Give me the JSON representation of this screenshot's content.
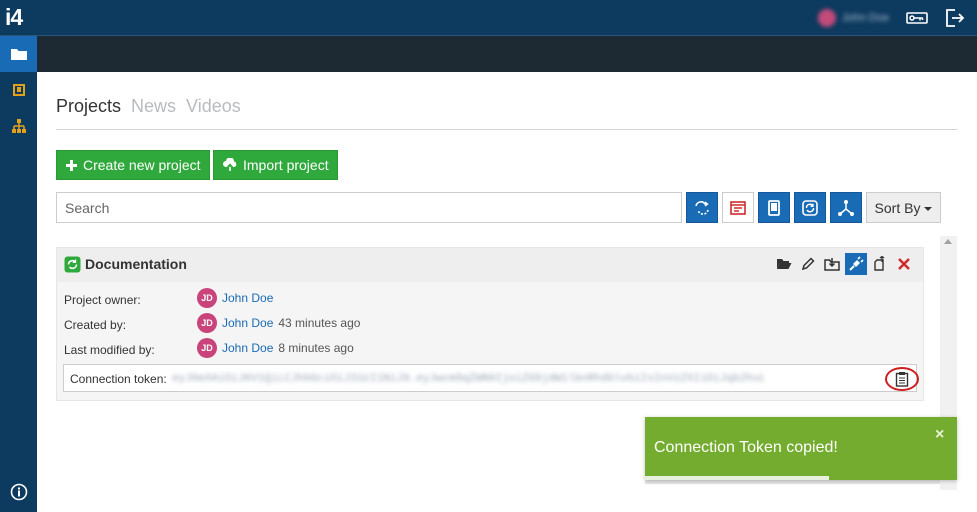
{
  "app": {
    "logo": "i4"
  },
  "topbar": {
    "user_name": "John Doe"
  },
  "tabs": [
    "Projects",
    "News",
    "Videos"
  ],
  "buttons": {
    "create": "Create new project",
    "import": "Import project"
  },
  "search": {
    "placeholder": "Search"
  },
  "sort": {
    "label": "Sort By"
  },
  "project": {
    "title": "Documentation",
    "owner_label": "Project owner:",
    "created_label": "Created by:",
    "modified_label": "Last modified by:",
    "token_label": "Connection token:",
    "owner_initials": "JD",
    "owner_name": "John Doe",
    "created_initials": "JD",
    "created_name": "John Doe",
    "created_ago": "43 minutes ago",
    "modified_initials": "JD",
    "modified_name": "John Doe",
    "modified_ago": "8 minutes ago",
    "token_value": "eyJ0eXAiOiJKV1QiLCJhbGciOiJIUzI1NiJ9.eyJwcm9qZWN0IjoiZG9jdW1lbnRhdGlvbiIsInVzZXIiOiJqb2huLmRvZSJ9.abcdEFGH"
  },
  "toast": {
    "message": "Connection Token copied!",
    "close": "×",
    "progress": 0.59
  },
  "colors": {
    "nav": "#0d3a5f",
    "accent": "#1a6bb5",
    "green": "#2fa93c",
    "toast": "#73ac2e",
    "danger": "#cc1f1f"
  },
  "icons": {
    "topbar": [
      "key-icon",
      "logout-icon"
    ],
    "sidebar": [
      "folder-icon",
      "book-icon",
      "sitemap-icon",
      "info-icon"
    ],
    "tools": [
      "sync-icon",
      "report-icon",
      "tablet-icon",
      "refresh-icon",
      "network-icon"
    ],
    "card_actions": [
      "open-folder-icon",
      "pencil-icon",
      "export-icon",
      "plug-icon",
      "duplicate-icon",
      "delete-icon"
    ]
  }
}
